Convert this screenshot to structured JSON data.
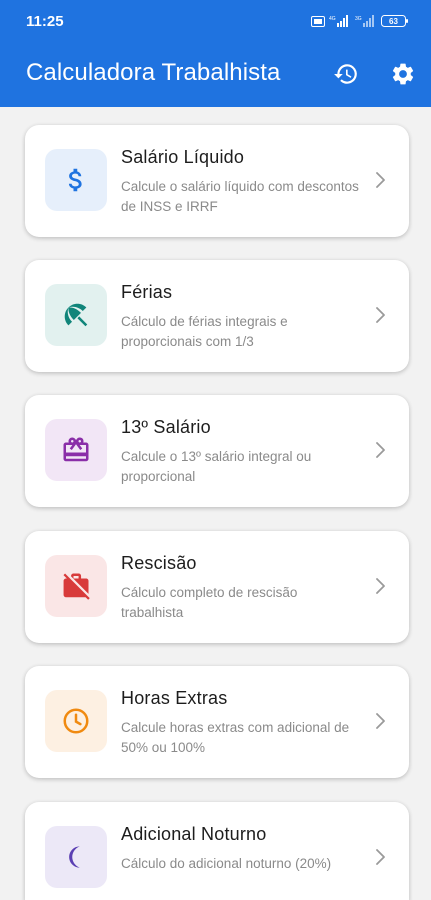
{
  "status_bar": {
    "time": "11:25",
    "network_1": "4G",
    "network_2": "3G",
    "battery": "63"
  },
  "app_bar": {
    "title": "Calculadora Trabalhista",
    "history_icon": "history-icon",
    "settings_icon": "gear-icon"
  },
  "colors": {
    "primary": "#1f73e0",
    "background": "#f2f2f2",
    "card": "#ffffff"
  },
  "cards": [
    {
      "title": "Salário Líquido",
      "description": "Calcule o salário líquido com descontos de INSS e IRRF",
      "icon": "dollar-icon",
      "icon_color": "#1f73e0",
      "icon_bg": "#e6effb"
    },
    {
      "title": "Férias",
      "description": "Cálculo de férias integrais e proporcionais com 1/3",
      "icon": "beach-umbrella-icon",
      "icon_color": "#10857a",
      "icon_bg": "#e2f1ef"
    },
    {
      "title": "13º Salário",
      "description": "Calcule o 13º salário integral ou proporcional",
      "icon": "gift-card-icon",
      "icon_color": "#8a2ea8",
      "icon_bg": "#f2e6f6"
    },
    {
      "title": "Rescisão",
      "description": "Cálculo completo de rescisão trabalhista",
      "icon": "work-off-icon",
      "icon_color": "#d83a3a",
      "icon_bg": "#fae6e6"
    },
    {
      "title": "Horas Extras",
      "description": "Calcule horas extras com adicional de 50% ou 100%",
      "icon": "clock-icon",
      "icon_color": "#f08a10",
      "icon_bg": "#fdf0e2"
    },
    {
      "title": "Adicional Noturno",
      "description": "Cálculo do adicional noturno (20%)",
      "icon": "moon-icon",
      "icon_color": "#5b3fb3",
      "icon_bg": "#ece8f7"
    }
  ]
}
